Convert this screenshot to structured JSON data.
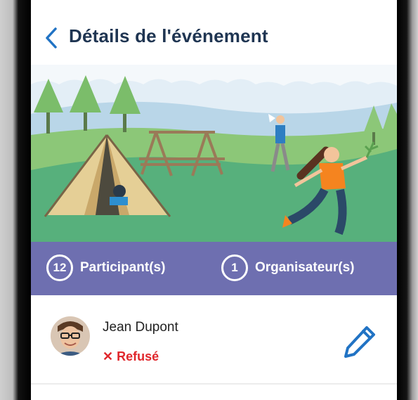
{
  "header": {
    "title": "Détails de l'événement"
  },
  "stats": {
    "participants_count": "12",
    "participants_label": "Participant(s)",
    "organizers_count": "1",
    "organizers_label": "Organisateur(s)"
  },
  "member": {
    "name": "Jean Dupont",
    "status_icon": "✕",
    "status_label": "Refusé"
  },
  "colors": {
    "title": "#1f3552",
    "accent_blue": "#2173c4",
    "stats_band": "#6e6fb0",
    "refused": "#e0272c"
  },
  "icons": [
    "chevron-left-icon",
    "pencil-icon"
  ]
}
